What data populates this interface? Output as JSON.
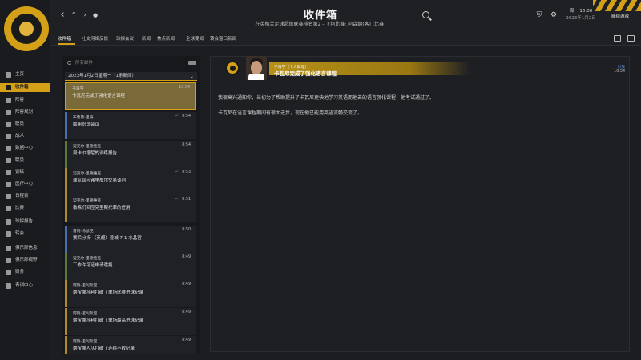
{
  "header": {
    "title": "收件箱",
    "subtitle": "在英格兰足球超级联赛排名第2 - 下场比赛: 阿森纳(客) (比赛)",
    "date_line1": "周一 16:00",
    "date_line2": "2023年1月2日",
    "continue_label": "继续游戏"
  },
  "sidebar": {
    "items": [
      {
        "label": "主页",
        "active": false
      },
      {
        "label": "收件箱",
        "active": true
      },
      {
        "label": "阵容",
        "active": false
      },
      {
        "label": "阵容规划",
        "active": false
      },
      {
        "label": "职员",
        "active": false
      },
      {
        "label": "战术",
        "active": false
      },
      {
        "label": "数据中心",
        "active": false
      },
      {
        "label": "职员",
        "active": false
      },
      {
        "label": "训练",
        "active": false
      },
      {
        "label": "医疗中心",
        "active": false
      },
      {
        "label": "日程表",
        "active": false
      },
      {
        "label": "比赛",
        "active": false
      },
      {
        "label": "球探报告",
        "active": false
      },
      {
        "label": "转会",
        "active": false
      },
      {
        "label": "俱乐部信息",
        "active": false
      },
      {
        "label": "俱乐部视野",
        "active": false
      },
      {
        "label": "财务",
        "active": false
      },
      {
        "label": "青训中心",
        "active": false
      }
    ]
  },
  "tabs": [
    {
      "label": "收件箱",
      "active": true
    },
    {
      "label": "社交网络反馈",
      "active": false
    },
    {
      "label": "球探会议",
      "active": false
    },
    {
      "label": "新闻",
      "active": false
    },
    {
      "label": "焦点新闻",
      "active": false
    },
    {
      "label": "全球要闻",
      "active": false
    },
    {
      "label": "转会窗口新闻",
      "active": false
    }
  ],
  "list": {
    "search_placeholder": "所有邮件",
    "group_header": "2023年1月2日星期一（1条新闻）",
    "messages": [
      {
        "sender": "于海学",
        "subject": "卡瓦尼完成了强化语言课程",
        "time": "10:54",
        "reply": "",
        "style": "selected"
      },
      {
        "sender": "布鲁斯·里奇",
        "subject": "聘用职员会议",
        "time": "8:54",
        "reply": "↩",
        "style": "blue"
      },
      {
        "sender": "迈克尔·里德维克",
        "subject": "周卡尔德尼的训练报告",
        "time": "8:54",
        "reply": "",
        "style": "green"
      },
      {
        "sender": "迈克尔·里德维克",
        "subject": "球队回应弗里皮尔交易谈判",
        "time": "8:53",
        "reply": "↩",
        "style": "gold"
      },
      {
        "sender": "迈克尔·里德维克",
        "subject": "教练们回应克里斯托菲的任用",
        "time": "8:51",
        "reply": "↩",
        "style": "gold"
      },
      {
        "sender": "雷内·马瑟克",
        "subject": "赛后分析 （英超）曼城 7-1 水晶宫",
        "time": "8:50",
        "reply": "",
        "style": "blue"
      },
      {
        "sender": "迈克尔·里德维克",
        "subject": "工作许可证申请遭拒",
        "time": "8:49",
        "reply": "",
        "style": "green"
      },
      {
        "sender": "阿隆·里利斯里",
        "subject": "朝宝娜科利打破了单场比赛进球纪录",
        "time": "8:49",
        "reply": "",
        "style": "gold"
      },
      {
        "sender": "阿隆·里利斯里",
        "subject": "朝宝娜科利打破了单场最高进球纪录",
        "time": "8:49",
        "reply": "",
        "style": "gold"
      },
      {
        "sender": "阿隆·里利斯里",
        "subject": "朝宝娜人队打破了连续不败纪录",
        "time": "8:49",
        "reply": "",
        "style": "gold"
      }
    ]
  },
  "message": {
    "from": "于海学（个人助理）",
    "title": "卡瓦尼完成了强化语言课程",
    "meta": "对我",
    "time": "10:54",
    "body": [
      "我很高兴通知你，当初为了帮助提升了卡瓦尼更快地学习英语而他去的语言强化课程，他考试通过了。",
      "卡瓦尼在语言课程期间有很大进步，现在他已能用英语流畅交流了。"
    ]
  },
  "colors": {
    "accent": "#d4a017",
    "background": "#1c1d21"
  }
}
